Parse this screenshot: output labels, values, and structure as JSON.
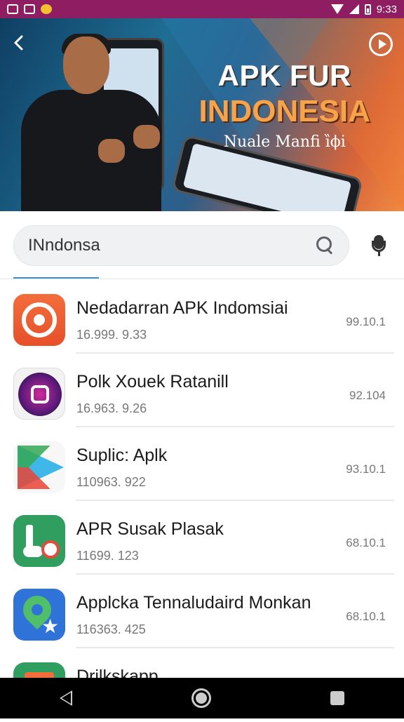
{
  "status_bar": {
    "time": "9:33",
    "background": "#8e1d62"
  },
  "banner": {
    "title_line1": "APK FUR",
    "title_line2": "INDONESIA",
    "subtitle": "Nuale Manfi ȉϕi"
  },
  "search": {
    "value": "INndonsa",
    "accent": "#3b8fd6"
  },
  "apps": [
    {
      "title": "Nedadarran APK Indomsiai",
      "subtitle": "16.999. 9.33",
      "version": "99.10.1",
      "icon": "orange-target-icon"
    },
    {
      "title": "Polk Xouek Ratanill",
      "subtitle": "16.963. 9.26",
      "version": "92.104",
      "icon": "camera-icon"
    },
    {
      "title": "Suplic: Aplk",
      "subtitle": "110963. 922",
      "version": "93.10.1",
      "icon": "play-store-icon"
    },
    {
      "title": "APR Susak Plasak",
      "subtitle": "11699. 123",
      "version": "68.10.1",
      "icon": "music-note-icon"
    },
    {
      "title": "Applcka Tennaludaird Monkan",
      "subtitle": "116363. 425",
      "version": "68.10.1",
      "icon": "map-pin-icon"
    },
    {
      "title": "Drilkskapp",
      "subtitle": "",
      "version": "",
      "icon": "green-app-icon"
    }
  ]
}
